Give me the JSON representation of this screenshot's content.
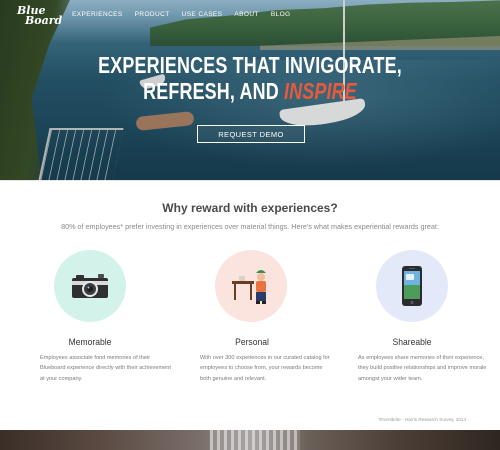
{
  "brand": {
    "logo_line1": "Blue",
    "logo_line2": "Board"
  },
  "nav": {
    "items": [
      {
        "label": "Experiences"
      },
      {
        "label": "Product"
      },
      {
        "label": "Use Cases"
      },
      {
        "label": "About"
      },
      {
        "label": "Blog"
      }
    ]
  },
  "hero": {
    "headline_line1": "EXPERIENCES THAT INVIGORATE,",
    "headline_line2_prefix": "REFRESH, AND ",
    "headline_accent": "INSPIRE",
    "cta_label": "REQUEST DEMO"
  },
  "section": {
    "title": "Why reward with experiences?",
    "subtitle": "80% of employees* prefer investing in experiences over material things. Here's what makes experiential rewards great:"
  },
  "features": [
    {
      "title": "Memorable",
      "icon": "camera-icon",
      "color": "#d2f2ea",
      "description": "Employees associate fond memories of their Blueboard experience directly with their achievement at your company."
    },
    {
      "title": "Personal",
      "icon": "person-at-table-icon",
      "color": "#fbe3de",
      "description": "With over 300 experiences in our curated catalog for employees to choose from, your rewards become both genuine and relevant."
    },
    {
      "title": "Shareable",
      "icon": "smartphone-icon",
      "color": "#e3e9f8",
      "description": "As employees share memories of their experience, they build positive relationships and improve morale amongst your wider team."
    }
  ],
  "footnote": "*Eventbrite - Harris Research Survey, 2014",
  "colors": {
    "accent": "#e85a3c",
    "text_dark": "#4a4a4a",
    "text_muted": "#8a8a8a"
  }
}
